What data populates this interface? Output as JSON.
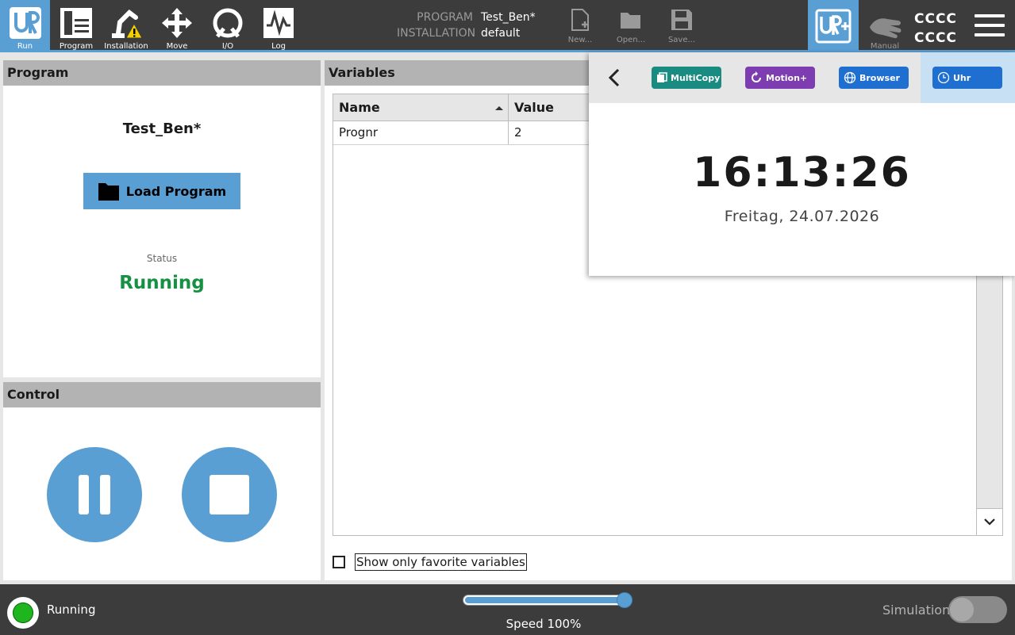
{
  "nav": {
    "run": "Run",
    "program": "Program",
    "installation": "Installation",
    "move": "Move",
    "io": "I/O",
    "log": "Log"
  },
  "program_info": {
    "program_key": "PROGRAM",
    "program_value": "Test_Ben*",
    "installation_key": "INSTALLATION",
    "installation_value": "default"
  },
  "file_menu": {
    "new": "New...",
    "open": "Open...",
    "save": "Save..."
  },
  "mode": {
    "manual": "Manual",
    "line1": "CCCC",
    "line2": "CCCC"
  },
  "program_panel": {
    "title": "Program",
    "program_name": "Test_Ben*",
    "load_button": "Load Program",
    "status_label": "Status",
    "status_value": "Running"
  },
  "control_panel": {
    "title": "Control"
  },
  "variables_panel": {
    "title": "Variables",
    "columns": [
      "Name",
      "Value"
    ],
    "rows": [
      {
        "name": "Prognr",
        "value": "2"
      }
    ],
    "favorite_label": "Show only favorite variables",
    "favorite_checked": false
  },
  "overlay": {
    "chips": {
      "multicopy": "MultiCopy",
      "motion": "Motion+",
      "browser": "Browser",
      "uhr": "Uhr"
    },
    "selected": "Uhr",
    "clock_time": "16:13:26",
    "clock_date": "Freitag, 24.07.2026"
  },
  "footer": {
    "status": "Running",
    "speed_label": "Speed 100%",
    "speed_fraction": 1.0,
    "simulation_label": "Simulation",
    "simulation_on": false
  },
  "colors": {
    "accent": "#5a9fd4",
    "topbar": "#3c3c3c",
    "running_green": "#149141",
    "multicopy": "#198b80",
    "motion": "#7d3cb0",
    "browser": "#1f6fd1"
  }
}
